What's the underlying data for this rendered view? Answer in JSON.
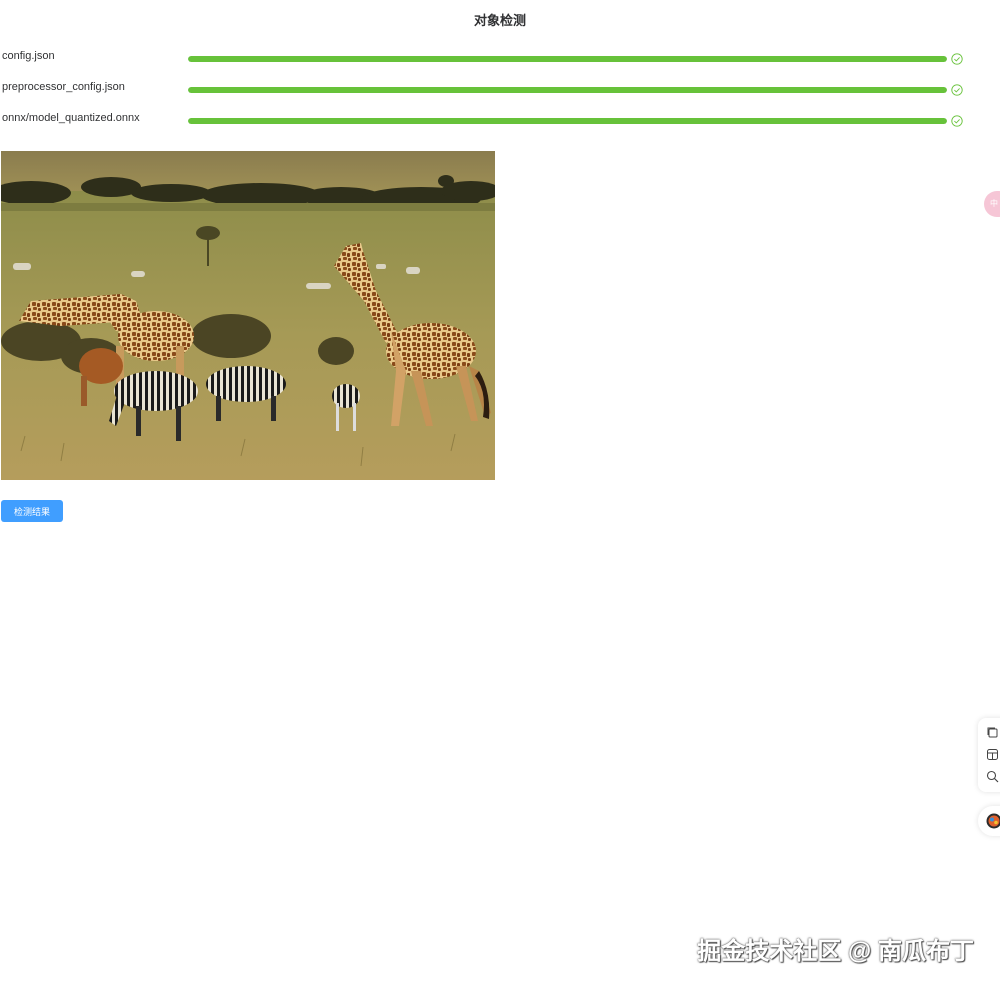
{
  "page": {
    "title": "对象检测"
  },
  "files": [
    {
      "name": "config.json",
      "progress": 100,
      "status": "success"
    },
    {
      "name": "preprocessor_config.json",
      "progress": 100,
      "status": "success"
    },
    {
      "name": "onnx/model_quantized.onnx",
      "progress": 100,
      "status": "success"
    }
  ],
  "image": {
    "subject": "giraffes and zebras grazing on savanna"
  },
  "actions": {
    "detect_label": "检测结果"
  },
  "sidebar": {
    "pill_label": "中",
    "tools": [
      "copy-icon",
      "layout-icon",
      "search-icon"
    ],
    "avatar_icon": "avatar-icon"
  },
  "watermark": {
    "text": "掘金技术社区 @ 南瓜布丁"
  },
  "colors": {
    "progress_success": "#67c23a",
    "progress_track": "#ebeef5",
    "button_primary": "#409eff"
  }
}
